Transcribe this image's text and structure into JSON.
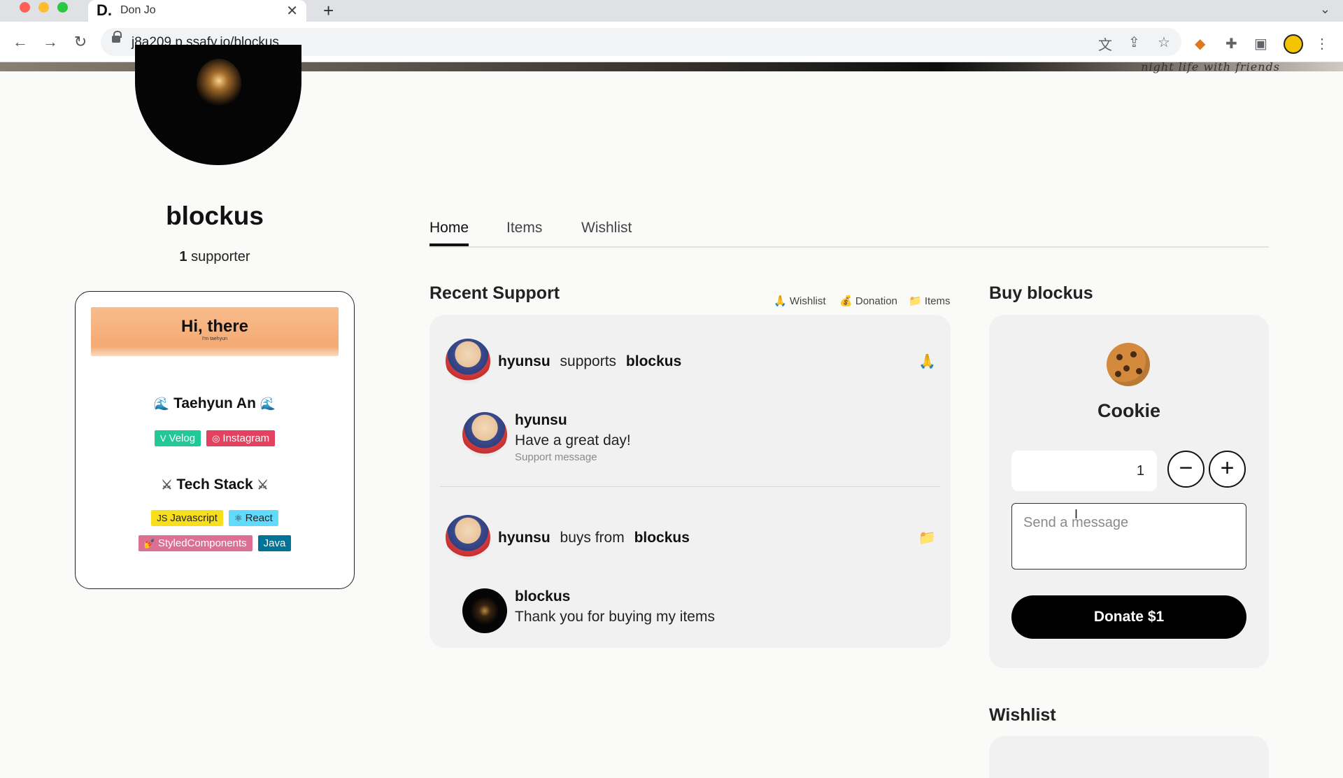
{
  "browser": {
    "tab_favicon": "D.",
    "tab_title": "Don Jo",
    "tab_close": "✕",
    "new_tab": "+",
    "tabs_menu": "⌄",
    "url": "j8a209.p.ssafy.io/blockus"
  },
  "banner": {
    "text": "night life with friends"
  },
  "profile": {
    "username": "blockus",
    "supporter_count": "1",
    "supporter_label": "supporter"
  },
  "about": {
    "hi_title": "Hi, there",
    "hi_subtitle": "I'm taehyun",
    "name": "Taehyun An",
    "links": [
      {
        "label": "Velog",
        "icon": "V"
      },
      {
        "label": "Instagram",
        "icon": "◎"
      }
    ],
    "stack_title": "Tech Stack",
    "stack": [
      {
        "label": "Javascript",
        "icon": "JS"
      },
      {
        "label": "React",
        "icon": "⚛"
      },
      {
        "label": "StyledComponents",
        "icon": "💅"
      },
      {
        "label": "Java",
        "icon": ""
      }
    ]
  },
  "tabs": [
    "Home",
    "Items",
    "Wishlist"
  ],
  "recent_support": {
    "title": "Recent Support",
    "legend": [
      {
        "icon": "🙏",
        "label": "Wishlist"
      },
      {
        "icon": "💰",
        "label": "Donation"
      },
      {
        "icon": "📁",
        "label": "Items"
      }
    ],
    "entries": [
      {
        "user": "hyunsu",
        "action": "supports",
        "target": "blockus",
        "type_icon": "🙏",
        "reply_name": "hyunsu",
        "reply_message": "Have a great day!",
        "reply_meta": "Support message"
      },
      {
        "user": "hyunsu",
        "action": "buys from",
        "target": "blockus",
        "type_icon": "📁",
        "reply_name": "blockus",
        "reply_message": "Thank you for buying my items",
        "reply_meta": ""
      }
    ]
  },
  "buy": {
    "title": "Buy blockus",
    "item_name": "Cookie",
    "quantity": "1",
    "minus": "−",
    "plus": "+",
    "message_placeholder": "Send a message",
    "donate_label": "Donate $1"
  },
  "wishlist": {
    "title": "Wishlist"
  }
}
